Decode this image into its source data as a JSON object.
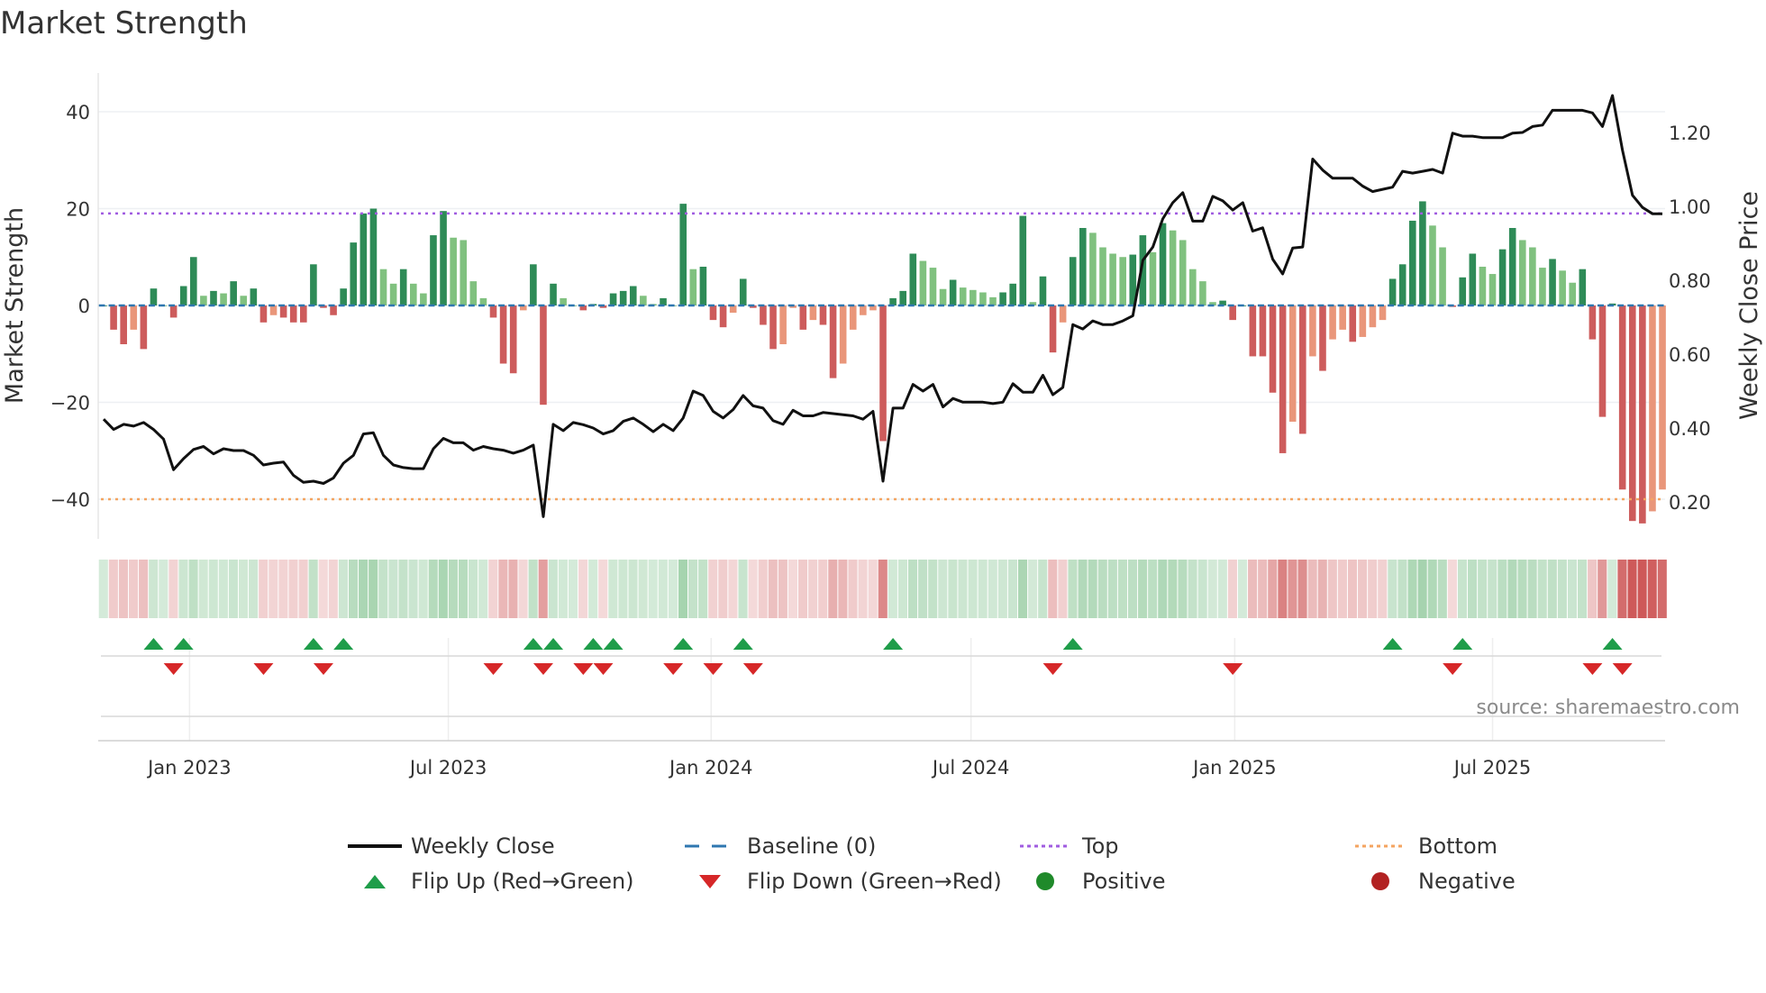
{
  "title": "Market Strength",
  "source": "source: sharemaestro.com",
  "legend": [
    {
      "label": "Weekly Close",
      "symbol": "line-icon",
      "color": "#111111"
    },
    {
      "label": "Baseline (0)",
      "symbol": "dash-icon",
      "color": "#2f77b0"
    },
    {
      "label": "Top",
      "symbol": "dotted-line-icon",
      "color": "#a05ce0"
    },
    {
      "label": "Bottom",
      "symbol": "dotted-line-icon",
      "color": "#f4a460"
    },
    {
      "label": "Flip Up (Red→Green)",
      "symbol": "triangle-up-icon",
      "color": "#1f9d4a"
    },
    {
      "label": "Flip Down (Green→Red)",
      "symbol": "triangle-down-icon",
      "color": "#d62728"
    },
    {
      "label": "Positive",
      "symbol": "circle-icon",
      "color": "#1f8a2a"
    },
    {
      "label": "Negative",
      "symbol": "circle-icon",
      "color": "#b22222"
    }
  ],
  "chart_data": {
    "type": "bar",
    "title": "Market Strength",
    "ylabel": "Market Strength",
    "y2label": "Weekly Close Price",
    "ylim": [
      -46,
      48
    ],
    "y2lim": [
      0.11,
      1.39
    ],
    "yticks": [
      "40",
      "20",
      "0",
      "−20",
      "−40"
    ],
    "yticks_values": [
      40,
      20,
      0,
      -20,
      -40
    ],
    "y2ticks": [
      "1.20",
      "1.00",
      "0.80",
      "0.60",
      "0.40",
      "0.20"
    ],
    "y2ticks_values": [
      1.2,
      1.0,
      0.8,
      0.6,
      0.4,
      0.2
    ],
    "xticks": [
      "Jan 2023",
      "Jul 2023",
      "Jan 2024",
      "Jul 2024",
      "Jan 2025",
      "Jul 2025"
    ],
    "xticks_week_index": [
      8.6,
      34.5,
      60.8,
      86.8,
      113.2,
      139
    ],
    "thresholds": {
      "top": 19,
      "bottom": -40
    },
    "colors": {
      "pos_rising": "#2e8b57",
      "pos_falling": "#80c17f",
      "neg_falling": "#cd5c5c",
      "neg_recovering": "#e9967a",
      "baseline": "#2f77b0",
      "top": "#a05ce0",
      "bottom": "#f4a460",
      "price": "#111111",
      "flip_up": "#1f9d4a",
      "flip_down": "#d62728"
    },
    "strength": [
      0,
      -5,
      -8,
      -5,
      -9,
      3.5,
      0,
      -2.5,
      4,
      10,
      2,
      3,
      2.5,
      5,
      2,
      3.5,
      -3.5,
      -2,
      -2.5,
      -3.5,
      -3.5,
      8.5,
      -0.5,
      -2,
      3.5,
      13,
      19,
      20,
      7.5,
      4.5,
      7.5,
      4.5,
      2.5,
      14.5,
      19.5,
      14,
      13.5,
      5,
      1.5,
      -2.5,
      -12,
      -14,
      -1,
      8.5,
      -20.5,
      4.5,
      1.5,
      0,
      -1,
      0.3,
      -0.5,
      2.5,
      3,
      4,
      2,
      0.3,
      1.5,
      0,
      21,
      7.5,
      8,
      -3,
      -4.5,
      -1.5,
      5.5,
      -0.5,
      -4,
      -9,
      -8,
      -0.5,
      -5,
      -3,
      -4,
      -15,
      -12,
      -5,
      -2,
      -1,
      -28,
      1.5,
      3,
      10.7,
      9.2,
      7.8,
      3.4,
      5.3,
      3.7,
      3.2,
      2.7,
      1.7,
      2.7,
      4.5,
      18.5,
      0.7,
      6,
      -9.7,
      -3.5,
      10,
      16,
      15,
      12,
      10.7,
      10,
      10.5,
      14.5,
      11,
      17,
      15.5,
      13.5,
      7.5,
      5,
      0.7,
      1,
      -3,
      0,
      -10.5,
      -10.5,
      -18,
      -30.5,
      -24,
      -26.5,
      -10.5,
      -13.5,
      -7,
      -5,
      -7.5,
      -6.5,
      -4.5,
      -3,
      5.5,
      8.5,
      17.5,
      21.5,
      16.5,
      12,
      -0.3,
      5.8,
      10.7,
      8,
      6.5,
      11.6,
      16,
      13.5,
      12,
      7.8,
      9.6,
      7.2,
      4.7,
      7.5,
      -7,
      -23,
      0.4,
      -38,
      -44.5,
      -45,
      -42.5,
      -38
    ],
    "weekly_close": [
      0.424,
      0.396,
      0.41,
      0.405,
      0.415,
      0.396,
      0.37,
      0.287,
      0.317,
      0.342,
      0.35,
      0.33,
      0.344,
      0.339,
      0.339,
      0.326,
      0.3,
      0.305,
      0.308,
      0.272,
      0.253,
      0.256,
      0.25,
      0.265,
      0.305,
      0.326,
      0.384,
      0.387,
      0.326,
      0.3,
      0.293,
      0.29,
      0.29,
      0.344,
      0.372,
      0.36,
      0.36,
      0.34,
      0.35,
      0.344,
      0.34,
      0.332,
      0.34,
      0.354,
      0.16,
      0.41,
      0.393,
      0.415,
      0.409,
      0.4,
      0.384,
      0.393,
      0.418,
      0.427,
      0.41,
      0.39,
      0.41,
      0.393,
      0.427,
      0.5,
      0.488,
      0.445,
      0.427,
      0.45,
      0.488,
      0.46,
      0.454,
      0.42,
      0.41,
      0.448,
      0.433,
      0.433,
      0.442,
      0.439,
      0.436,
      0.433,
      0.424,
      0.445,
      0.256,
      0.454,
      0.454,
      0.518,
      0.5,
      0.518,
      0.457,
      0.48,
      0.47,
      0.47,
      0.47,
      0.466,
      0.47,
      0.52,
      0.497,
      0.497,
      0.543,
      0.49,
      0.51,
      0.68,
      0.668,
      0.69,
      0.68,
      0.68,
      0.69,
      0.704,
      0.854,
      0.89,
      0.966,
      1.01,
      1.037,
      0.96,
      0.96,
      1.027,
      1.015,
      0.99,
      1.01,
      0.933,
      0.942,
      0.857,
      0.817,
      0.887,
      0.89,
      1.128,
      1.098,
      1.076,
      1.076,
      1.076,
      1.055,
      1.04,
      1.046,
      1.052,
      1.095,
      1.09,
      1.095,
      1.1,
      1.09,
      1.198,
      1.19,
      1.19,
      1.186,
      1.186,
      1.186,
      1.198,
      1.2,
      1.216,
      1.22,
      1.26,
      1.26,
      1.26,
      1.26,
      1.253,
      1.216,
      1.3,
      1.152,
      1.03,
      0.997,
      0.98,
      0.98
    ],
    "flip_up_week_index": [
      5,
      8,
      21,
      24,
      43,
      45,
      49,
      51,
      58,
      64,
      79,
      97,
      129,
      136,
      151
    ],
    "flip_down_week_index": [
      7,
      16,
      22,
      39,
      44,
      48,
      50,
      57,
      61,
      65,
      95,
      113,
      135,
      149,
      152
    ],
    "grid": true,
    "legend_position": "bottom"
  }
}
